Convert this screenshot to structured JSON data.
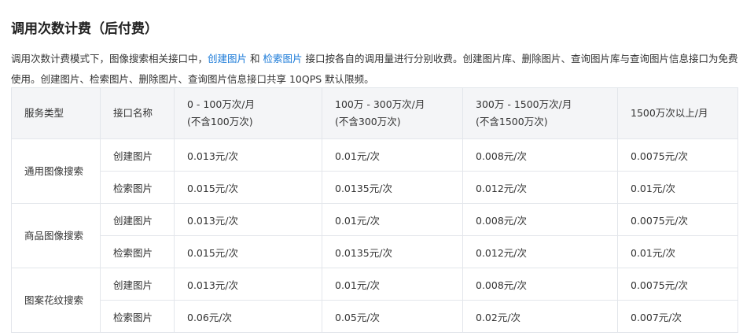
{
  "heading": "调用次数计费（后付费）",
  "description": {
    "part1": "调用次数计费模式下，图像搜索相关接口中，",
    "link1": "创建图片",
    "and": " 和 ",
    "link2": "检索图片",
    "part2": " 接口按各自的调用量进行分别收费。创建图片库、删除图片、查询图片库与查询图片信息接口为免费使用。创建图片、检索图片、删除图片、查询图片信息接口共享 10QPS 默认限频。"
  },
  "table": {
    "headers": {
      "service": "服务类型",
      "api": "接口名称",
      "tier1": {
        "line1": "0 - 100万次/月",
        "line2": "(不含100万次)"
      },
      "tier2": {
        "line1": "100万 - 300万次/月",
        "line2": "(不含300万次)"
      },
      "tier3": {
        "line1": "300万 - 1500万次/月",
        "line2": "(不含1500万次)"
      },
      "tier4": {
        "line1": "1500万次以上/月"
      }
    },
    "groups": [
      {
        "service": "通用图像搜索",
        "rows": [
          {
            "api": "创建图片",
            "prices": [
              "0.013元/次",
              "0.01元/次",
              "0.008元/次",
              "0.0075元/次"
            ]
          },
          {
            "api": "检索图片",
            "prices": [
              "0.015元/次",
              "0.0135元/次",
              "0.012元/次",
              "0.01元/次"
            ]
          }
        ]
      },
      {
        "service": "商品图像搜索",
        "rows": [
          {
            "api": "创建图片",
            "prices": [
              "0.013元/次",
              "0.01元/次",
              "0.008元/次",
              "0.0075元/次"
            ]
          },
          {
            "api": "检索图片",
            "prices": [
              "0.015元/次",
              "0.0135元/次",
              "0.012元/次",
              "0.01元/次"
            ]
          }
        ]
      },
      {
        "service": "图案花纹搜索",
        "rows": [
          {
            "api": "创建图片",
            "prices": [
              "0.013元/次",
              "0.01元/次",
              "0.008元/次",
              "0.0075元/次"
            ]
          },
          {
            "api": "检索图片",
            "prices": [
              "0.06元/次",
              "0.05元/次",
              "0.02元/次",
              "0.007元/次"
            ]
          }
        ]
      }
    ]
  },
  "colors": {
    "link": "#1a7ad8",
    "header_bg": "#f4f5f7",
    "border": "#e3e6eb"
  }
}
